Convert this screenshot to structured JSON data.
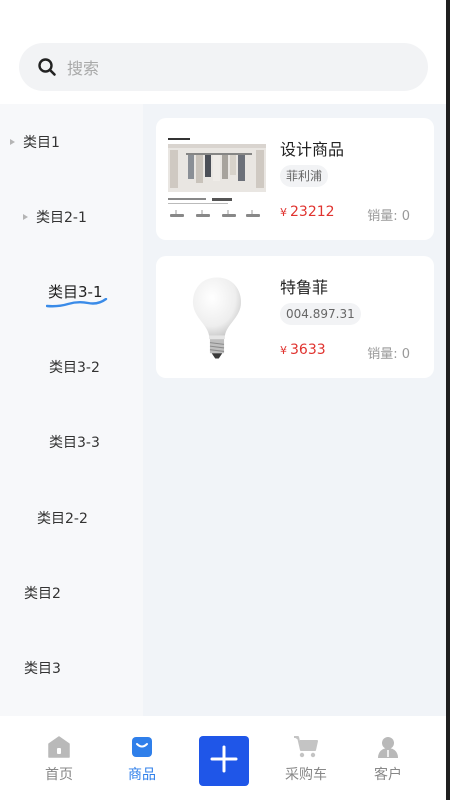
{
  "search": {
    "placeholder": "搜索"
  },
  "sidebar": {
    "items": [
      {
        "label": "类目1"
      },
      {
        "label": "类目2-1"
      },
      {
        "label": "类目3-1"
      },
      {
        "label": "类目3-2"
      },
      {
        "label": "类目3-3"
      },
      {
        "label": "类目2-2"
      },
      {
        "label": "类目2"
      },
      {
        "label": "类目3"
      }
    ],
    "active_label": "类目3-1"
  },
  "products": [
    {
      "title": "设计商品",
      "tag": "菲利浦",
      "price": "23212",
      "currency": "¥",
      "sales": "销量: 0",
      "image": "clothes-rack-lighting-image"
    },
    {
      "title": "特鲁菲",
      "tag": "004.897.31",
      "price": "3633",
      "currency": "¥",
      "sales": "销量: 0",
      "image": "light-bulb-image"
    }
  ],
  "tabbar": {
    "items": [
      {
        "label": "首页",
        "icon": "home-icon"
      },
      {
        "label": "商品",
        "icon": "bag-icon"
      },
      {
        "label": "",
        "icon": "plus-icon"
      },
      {
        "label": "采购车",
        "icon": "cart-icon"
      },
      {
        "label": "客户",
        "icon": "person-icon"
      }
    ],
    "active_index": 1
  },
  "colors": {
    "accent": "#2f7fea",
    "add_button": "#1f56e8",
    "price": "#e0332f",
    "sidebar_bg": "#f7f8fa",
    "content_bg": "#f1f4f8"
  }
}
